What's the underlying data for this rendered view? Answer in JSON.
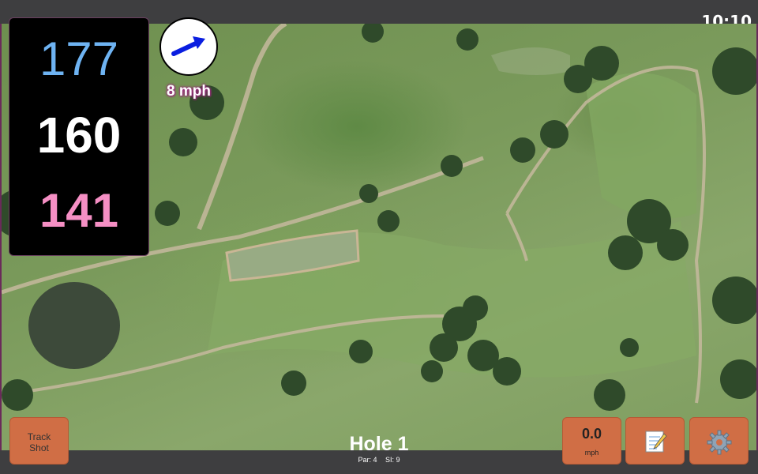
{
  "status": {
    "time": "10:10"
  },
  "distances": {
    "back": "177",
    "middle": "160",
    "front": "141"
  },
  "wind": {
    "speed": "8 mph",
    "arrow_icon": "wind-arrow-icon"
  },
  "hole": {
    "title": "Hole 1",
    "par": "Par: 4",
    "stroke_index": "SI: 9"
  },
  "buttons": {
    "track_shot_line1": "Track",
    "track_shot_line2": "Shot",
    "speed_value": "0.0",
    "speed_unit": "mph",
    "notes_icon": "notepad-icon",
    "settings_icon": "gear-icon"
  },
  "colors": {
    "back": "#6eb3f2",
    "middle": "#ffffff",
    "front": "#f58fc4",
    "button": "#d06e45",
    "wind_text_outline": "#9b2a7e"
  }
}
